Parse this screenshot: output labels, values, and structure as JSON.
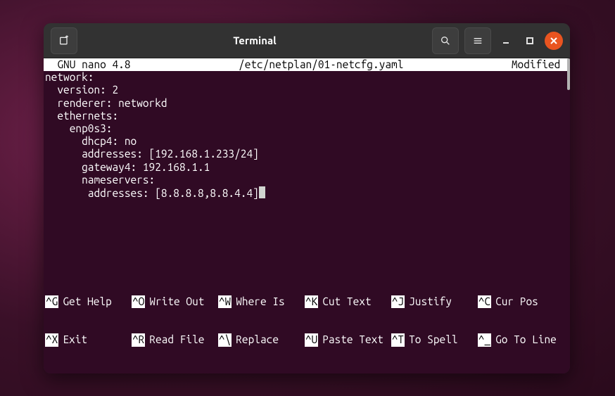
{
  "titlebar": {
    "title": "Terminal"
  },
  "nano": {
    "status_left": "  GNU nano 4.8",
    "status_file": "/etc/netplan/01-netcfg.yaml",
    "status_right": "Modified "
  },
  "content": {
    "l0": "network:",
    "l1": "  version: 2",
    "l2": "  renderer: networkd",
    "l3": "  ethernets:",
    "l4": "    enp0s3:",
    "l5": "      dhcp4: no",
    "l6": "      addresses: [192.168.1.233/24]",
    "l7": "      gateway4: 192.168.1.1",
    "l8": "      nameservers:",
    "l9": "       addresses: [8.8.8.8,8.8.4.4]"
  },
  "shortcuts": {
    "r1": {
      "k0": "^G",
      "l0": "Get Help",
      "k1": "^O",
      "l1": "Write Out",
      "k2": "^W",
      "l2": "Where Is",
      "k3": "^K",
      "l3": "Cut Text",
      "k4": "^J",
      "l4": "Justify",
      "k5": "^C",
      "l5": "Cur Pos"
    },
    "r2": {
      "k0": "^X",
      "l0": "Exit",
      "k1": "^R",
      "l1": "Read File",
      "k2": "^\\",
      "l2": "Replace",
      "k3": "^U",
      "l3": "Paste Text",
      "k4": "^T",
      "l4": "To Spell",
      "k5": "^_",
      "l5": "Go To Line"
    }
  }
}
